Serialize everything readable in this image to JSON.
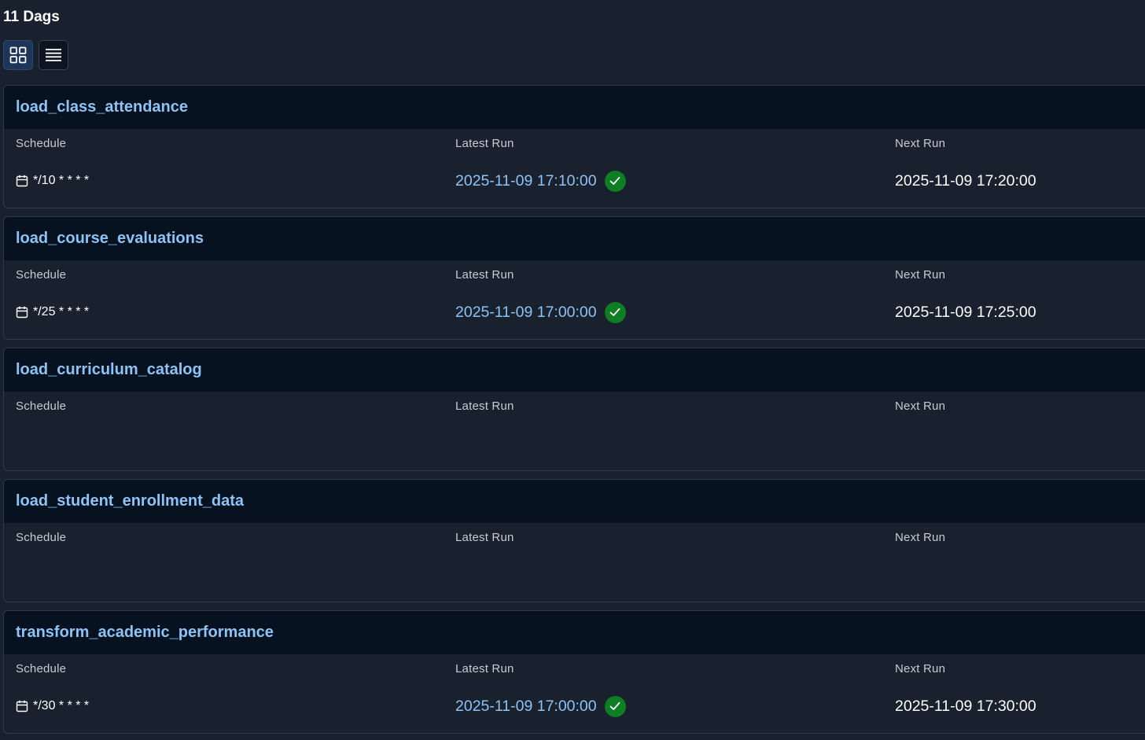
{
  "header": {
    "title": "11 Dags"
  },
  "view_toggle": {
    "grid_icon": "grid-icon",
    "list_icon": "list-icon"
  },
  "labels": {
    "schedule": "Schedule",
    "latest_run": "Latest Run",
    "next_run": "Next Run"
  },
  "colors": {
    "link": "#8fc2f5",
    "success": "#0e7d24",
    "card_header": "#061220",
    "background": "#19202e"
  },
  "dags": [
    {
      "name": "load_class_attendance",
      "schedule": "*/10 * * * *",
      "latest_run": "2025-11-09 17:10:00",
      "latest_status": "success",
      "next_run": "2025-11-09 17:20:00"
    },
    {
      "name": "load_course_evaluations",
      "schedule": "*/25 * * * *",
      "latest_run": "2025-11-09 17:00:00",
      "latest_status": "success",
      "next_run": "2025-11-09 17:25:00"
    },
    {
      "name": "load_curriculum_catalog",
      "schedule": "",
      "latest_run": "",
      "latest_status": "",
      "next_run": ""
    },
    {
      "name": "load_student_enrollment_data",
      "schedule": "",
      "latest_run": "",
      "latest_status": "",
      "next_run": ""
    },
    {
      "name": "transform_academic_performance",
      "schedule": "*/30 * * * *",
      "latest_run": "2025-11-09 17:00:00",
      "latest_status": "success",
      "next_run": "2025-11-09 17:30:00"
    }
  ]
}
